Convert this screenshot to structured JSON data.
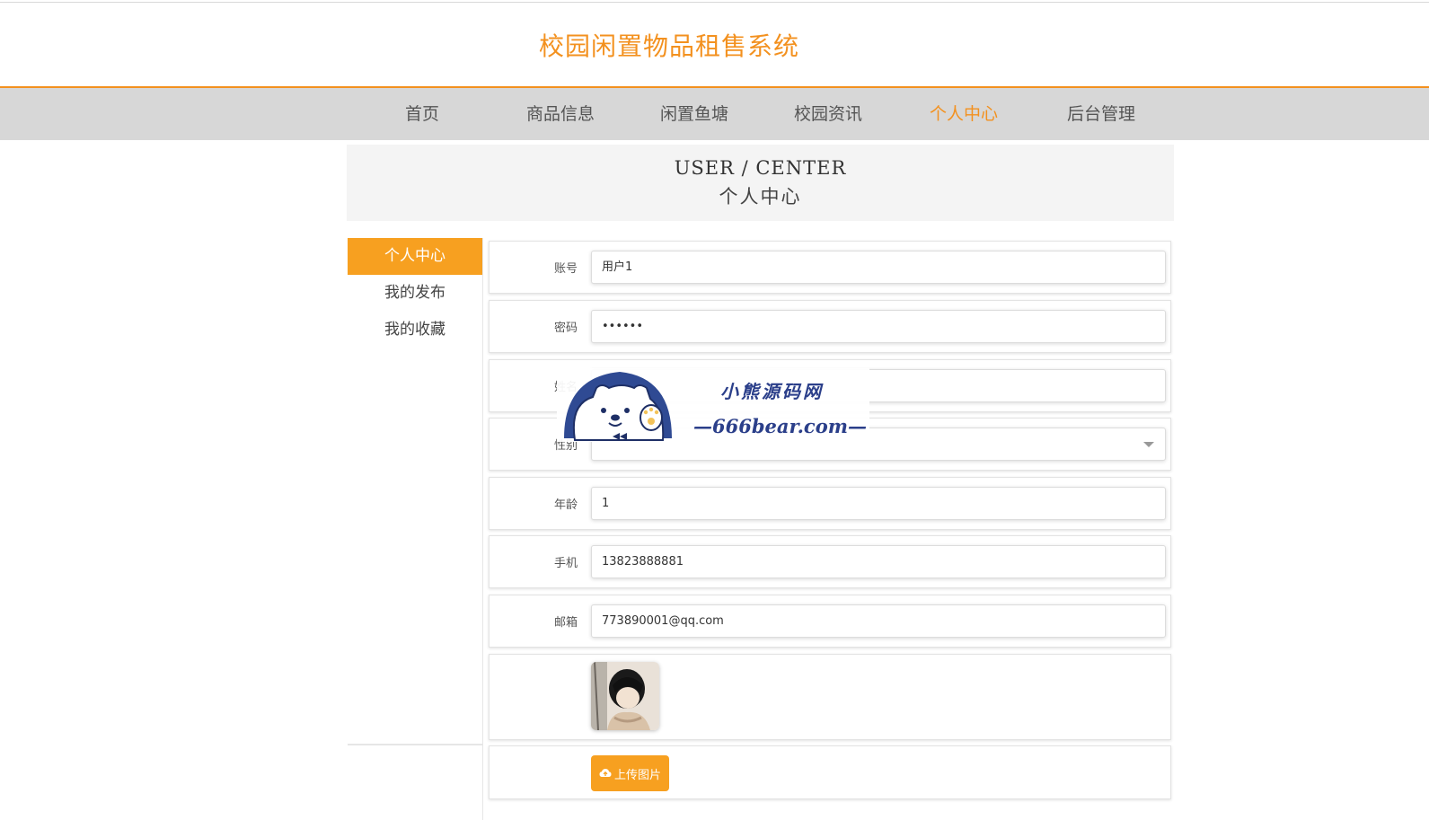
{
  "site": {
    "title": "校园闲置物品租售系统"
  },
  "nav": {
    "items": [
      {
        "label": "首页"
      },
      {
        "label": "商品信息"
      },
      {
        "label": "闲置鱼塘"
      },
      {
        "label": "校园资讯"
      },
      {
        "label": "个人中心"
      },
      {
        "label": "后台管理"
      }
    ],
    "active": "个人中心"
  },
  "banner": {
    "en": "USER / CENTER",
    "cn": "个人中心"
  },
  "sidebar": {
    "items": [
      {
        "label": "个人中心"
      },
      {
        "label": "我的发布"
      },
      {
        "label": "我的收藏"
      }
    ]
  },
  "form": {
    "account": {
      "label": "账号",
      "value": "用户1"
    },
    "password": {
      "label": "密码",
      "value": "••••••"
    },
    "name": {
      "label": "姓名",
      "value": ""
    },
    "gender": {
      "label": "性别",
      "value": ""
    },
    "age": {
      "label": "年龄",
      "value": "1"
    },
    "phone": {
      "label": "手机",
      "value": "13823888881"
    },
    "email": {
      "label": "邮箱",
      "value": "773890001@qq.com"
    },
    "upload_label": "上传图片"
  },
  "watermark": {
    "line1": "小熊源码网",
    "line2": "—666bear.com—"
  },
  "colors": {
    "accent": "#f3911f",
    "button": "#f7a020",
    "nav_bg": "#d7d7d7",
    "watermark": "#2b3f8a"
  }
}
